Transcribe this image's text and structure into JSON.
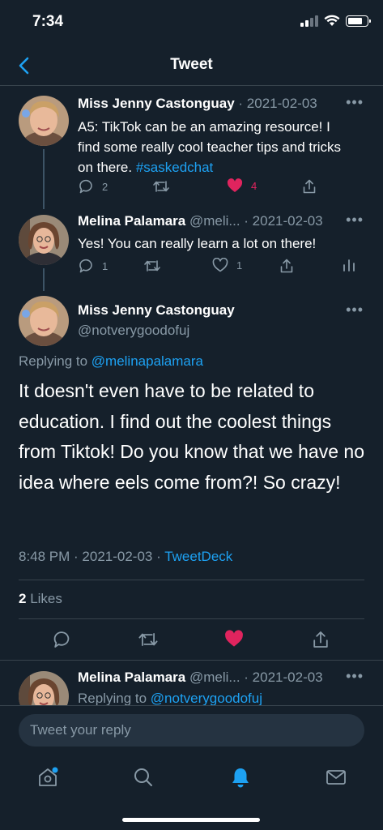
{
  "status_bar": {
    "time": "7:34"
  },
  "nav": {
    "title": "Tweet"
  },
  "thread": [
    {
      "name": "Miss Jenny Castonguay",
      "meta": " · 2021-02-03",
      "text": "A5: TikTok can be an amazing resource! I find some really cool teacher tips and tricks on there. ",
      "hashtag": "#saskedchat",
      "reply_count": "2",
      "retweet_count": "",
      "like_count": "4",
      "liked": true
    },
    {
      "name": "Melina Palamara",
      "meta": " @meli... · 2021-02-03",
      "text": "Yes! You can really learn a lot on there!",
      "reply_count": "1",
      "retweet_count": "",
      "like_count": "1",
      "liked": false
    }
  ],
  "main_tweet": {
    "name": "Miss Jenny Castonguay",
    "handle": "@notverygoodofuj",
    "replying_prefix": "Replying to ",
    "replying_to": "@melinapalamara",
    "text": "It doesn't even have to be related to education. I find out the coolest things from Tiktok! Do you know that we have no idea where eels come from?! So crazy!",
    "timestamp": "8:48 PM · 2021-02-03 · ",
    "source": "TweetDeck",
    "likes_count": "2",
    "likes_label": " Likes"
  },
  "reply_preview": {
    "name": "Melina Palamara",
    "meta": " @meli... · 2021-02-03",
    "replying_prefix": "Replying to ",
    "replying_to": "@notverygoodofuj"
  },
  "reply_bar": {
    "placeholder": "Tweet your reply"
  },
  "tab_bar": {
    "tabs": [
      "home-icon",
      "search-icon",
      "notifications-icon",
      "messages-icon"
    ],
    "active": "notifications-icon"
  },
  "colors": {
    "background": "#15202b",
    "accent": "#1da1f2",
    "like": "#e0245e",
    "muted": "#8899a6",
    "divider": "#38444d"
  }
}
